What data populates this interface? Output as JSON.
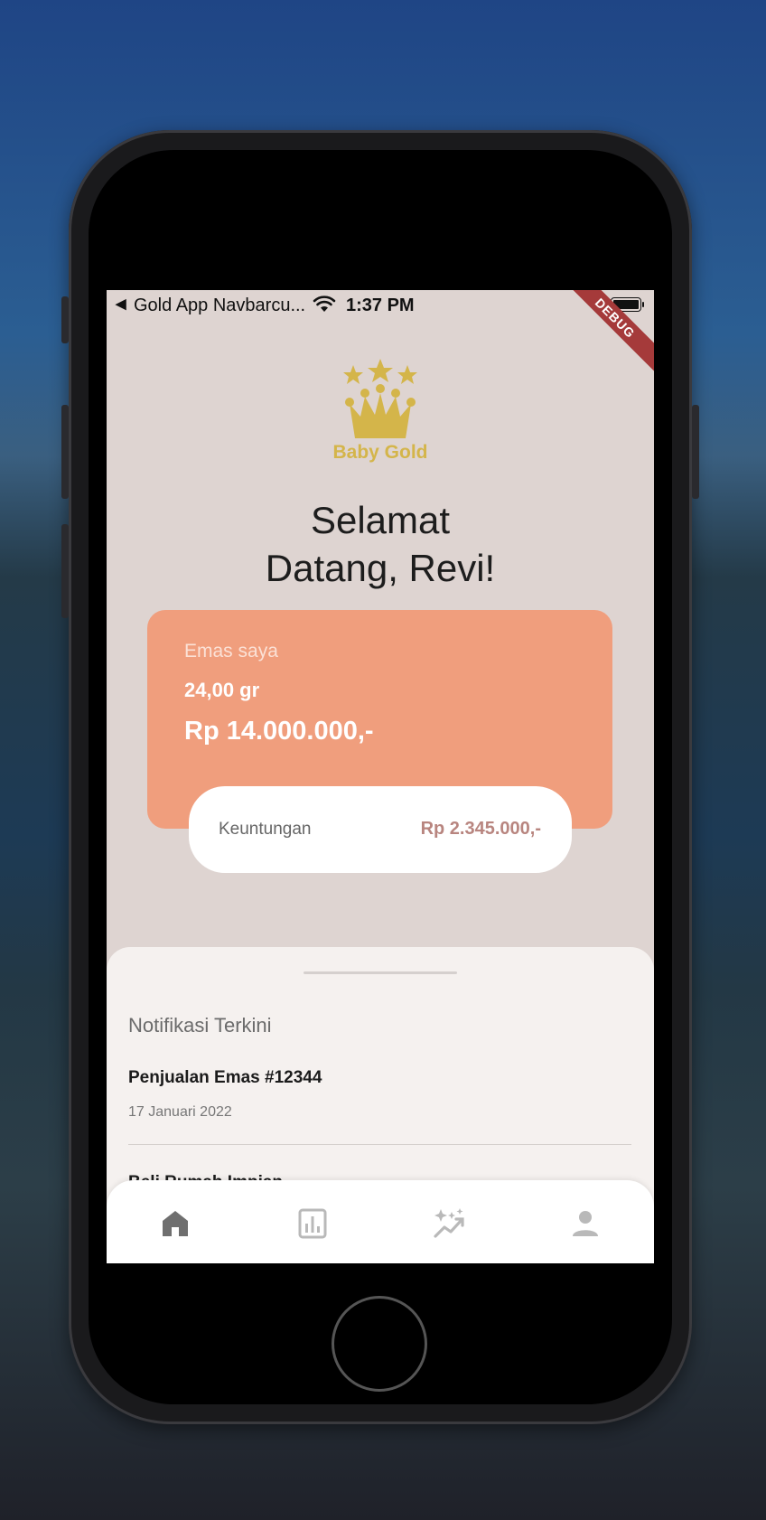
{
  "status_bar": {
    "back_glyph": "◀",
    "carrier": "Gold App Navbarcu...",
    "time": "1:37 PM",
    "debug": "DEBUG"
  },
  "logo": {
    "text": "Baby Gold",
    "color": "#d4b54a"
  },
  "welcome": {
    "line1": "Selamat",
    "line2": "Datang, Revi!"
  },
  "gold_card": {
    "label": "Emas saya",
    "grams": "24,00 gr",
    "value": "Rp 14.000.000,-",
    "color": "#f09e7d"
  },
  "profit_card": {
    "label": "Keuntungan",
    "value": "Rp 2.345.000,-"
  },
  "notifications": {
    "title": "Notifikasi Terkini",
    "items": [
      {
        "title": "Penjualan Emas #12344",
        "date": "17 Januari 2022"
      },
      {
        "title": "Beli Rumah Impian"
      }
    ]
  },
  "navbar": {
    "items": [
      {
        "icon": "home-icon",
        "active": true
      },
      {
        "icon": "chart-icon",
        "active": false
      },
      {
        "icon": "trending-icon",
        "active": false
      },
      {
        "icon": "person-icon",
        "active": false
      }
    ]
  }
}
